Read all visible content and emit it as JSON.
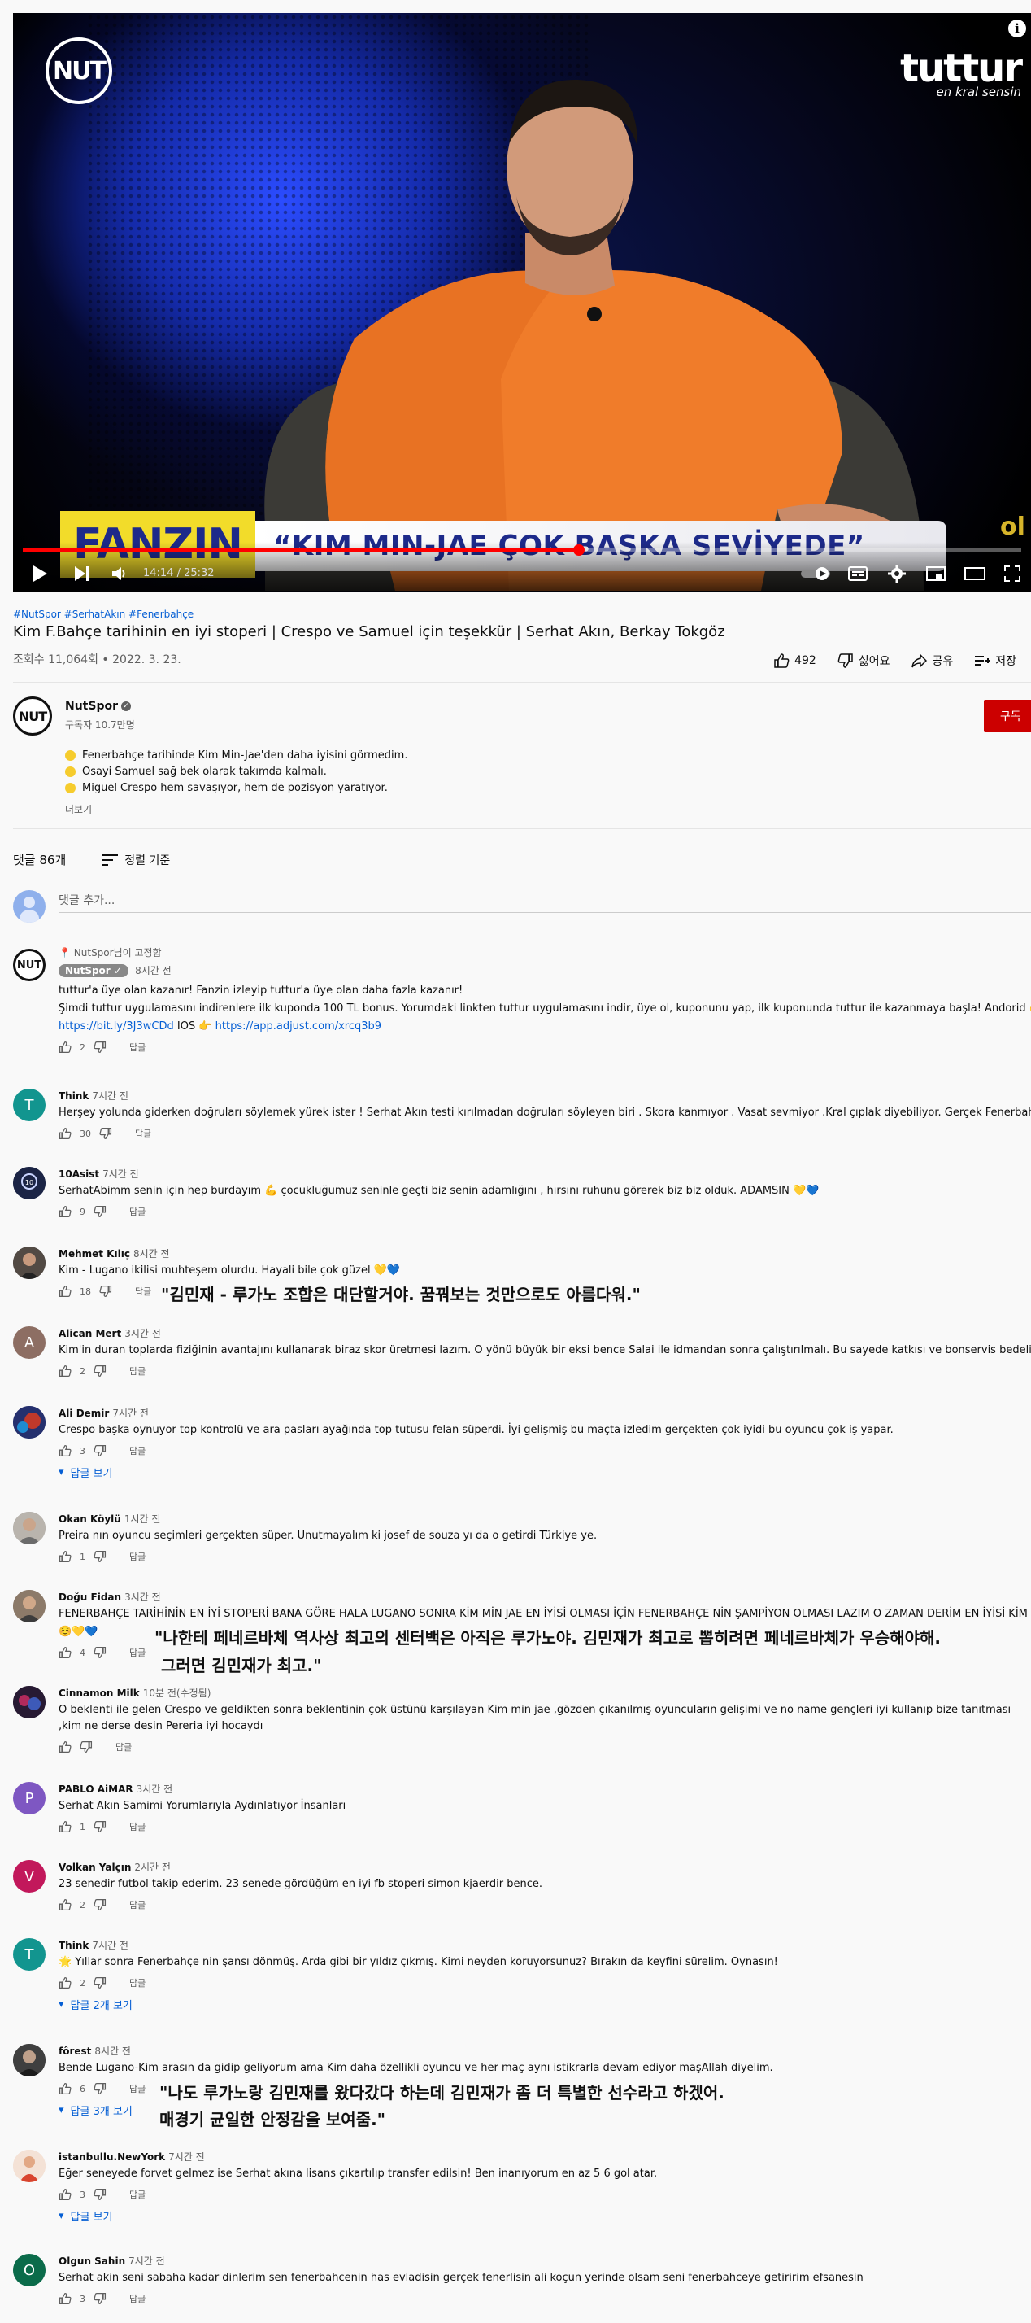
{
  "video": {
    "channel_logo_text": "NUT",
    "brand_main": "tuttur",
    "brand_sub": "en kral sensin",
    "lower_third_box": "FANZIN",
    "lower_third_headline": "“KIM MIN-JAE ÇOK BAŞKA SEVİYEDE”",
    "corner_text": "ol",
    "time_display": "14:14 / 25:32",
    "progress_fraction": 0.557
  },
  "info": {
    "tags": "#NutSpor #SerhatAkın #Fenerbahçe",
    "title": "Kim F.Bahçe tarihinin en iyi stoperi | Crespo ve Samuel için teşekkür | Serhat Akın, Berkay Tokgöz",
    "meta": "조회수 11,064회 • 2022. 3. 23.",
    "like_count": "492",
    "dislike_label": "싫어요",
    "share_label": "공유",
    "save_label": "저장"
  },
  "channel": {
    "avatar_text": "NUT",
    "name": "NutSpor",
    "subs": "구독자 10.7만명",
    "subscribe_label": "구독",
    "desc_lines": [
      "Fenerbahçe tarihinde Kim Min-Jae'den daha iyisini görmedim.",
      "Osayi Samuel sağ bek olarak takımda kalmalı.",
      "Miguel Crespo hem savaşıyor, hem de pozisyon yaratıyor."
    ],
    "more_label": "더보기"
  },
  "comments_header": {
    "count": "댓글 86개",
    "sort_label": "정렬 기준",
    "add_placeholder": "댓글 추가..."
  },
  "comments": [
    {
      "pinned": "NutSpor님이 고정함",
      "author": "NutSpor",
      "time": "8시간 전",
      "lines": [
        "tuttur'a üye olan kazanır! Fanzin izleyip tuttur'a üye olan daha fazla kazanır!",
        "Şimdi tuttur uygulamasını indirenlere ilk kuponda 100 TL bonus. Yorumdaki linkten tuttur uygulamasını indir, üye ol, kuponunu yap, ilk kuponunda tuttur ile kazanmaya başla!  Andorid 👉"
      ],
      "link1": "https://bit.ly/3J3wCDd",
      "ios_label": "IOS 👉",
      "link2": "https://app.adjust.com/xrcq3b9",
      "likes": "2",
      "reply": "답글"
    },
    {
      "avatar_letter": "T",
      "author": "Think",
      "time": "7시간 전",
      "text": "Herşey yolunda giderken doğruları söylemek yürek ister ! Serhat Akın testi kırılmadan doğruları söyleyen biri . Skora kanmıyor . Vasat sevmiyor .Kral çıplak diyebiliyor. Gerçek Fenerbahçeli !",
      "likes": "30",
      "reply": "답글"
    },
    {
      "author": "10Asist",
      "time": "7시간 전",
      "text": "SerhatAbimm senin için hep burdayım 💪 çocukluğumuz seninle geçti biz senin adamlığını , hırsını ruhunu görerek biz biz olduk. ADAMSIN 💛💙",
      "likes": "9",
      "reply": "답글"
    },
    {
      "author": "Mehmet Kılıç",
      "time": "8시간 전",
      "text": "Kim - Lugano ikilisi muhteşem olurdu. Hayali bile çok güzel 💛💙",
      "likes": "18",
      "reply": "답글",
      "overlay": "\"김민재 - 루가노 조합은 대단할거야. 꿈꿔보는 것만으로도 아름다워.\""
    },
    {
      "avatar_letter": "A",
      "author": "Alican Mert",
      "time": "3시간 전",
      "text": "Kim'in duran toplarda fiziğinin avantajını kullanarak biraz skor üretmesi lazım. O yönü büyük bir eksi bence  Salai ile idmandan sonra çalıştırılmalı. Bu sayede katkısı ve bonservis bedeli katlanabilir",
      "likes": "2",
      "reply": "답글"
    },
    {
      "author": "Ali Demir",
      "time": "7시간 전",
      "text": "Crespo başka oynuyor top kontrolü ve ara pasları ayağında top tutusu felan süperdi. İyi gelişmiş bu maçta izledim gerçekten çok iyidi bu oyuncu çok iş yapar.",
      "likes": "3",
      "reply": "답글",
      "view_replies": "답글 보기"
    },
    {
      "author": "Okan Köylü",
      "time": "1시간 전",
      "text": "Preira nın oyuncu seçimleri gerçekten süper. Unutmayalım ki josef de souza yı da o getirdi Türkiye ye.",
      "likes": "1",
      "reply": "답글"
    },
    {
      "author": "Doğu Fidan",
      "time": "3시간 전",
      "text": "FENERBAHÇE TARİHİNİN EN İYİ STOPERİ BANA GÖRE HALA LUGANO SONRA KİM MİN JAE EN İYİSİ OLMASI İÇİN FENERBAHÇE NİN ŞAMPİYON OLMASI LAZIM O ZAMAN DERİM EN İYİSİ KİM",
      "emoji": "☺️💛💙",
      "likes": "4",
      "reply": "답글",
      "overlay1": "\"나한테 페네르바체 역사상 최고의 센터백은 아직은 루가노야. 김민재가 최고로 뽑히려면 페네르바체가 우승해야해.",
      "overlay2": "그러면 김민재가 최고.\""
    },
    {
      "author": "Cinnamon Milk",
      "time": "10분 전(수정됨)",
      "text": "O beklenti ile gelen Crespo ve geldikten sonra beklentinin çok üstünü karşılayan Kim min jae ,gözden çıkanılmış oyuncuların gelişimi ve no name gençleri iyi kullanıp bize tanıtması ,kim ne derse desin Pereria iyi hocaydı",
      "reply": "답글"
    },
    {
      "avatar_letter": "P",
      "author": "PABLO AiMAR",
      "time": "3시간 전",
      "text": "Serhat Akın Samimi Yorumlarıyla Aydınlatıyor İnsanları",
      "likes": "1",
      "reply": "답글"
    },
    {
      "avatar_letter": "V",
      "author": "Volkan Yalçın",
      "time": "2시간 전",
      "text": "23 senedir futbol takip ederim. 23 senede gördüğüm en iyi fb stoperi simon kjaerdir bence.",
      "likes": "2",
      "reply": "답글"
    },
    {
      "avatar_letter": "T",
      "author": "Think",
      "time": "7시간 전",
      "text": "🌟 Yıllar sonra Fenerbahçe nin şansı dönmüş. Arda gibi bir yıldız çıkmış. Kimi neyden koruyorsunuz? Bırakın da keyfini sürelim. Oynasın!",
      "likes": "2",
      "reply": "답글",
      "view_replies": "답글 2개 보기"
    },
    {
      "author": "fôrest",
      "time": "8시간 전",
      "text": "Bende Lugano-Kim arasın da gidip geliyorum ama Kim daha özellikli oyuncu  ve her maç aynı istikrarla devam ediyor maşAllah diyelim.",
      "likes": "6",
      "reply": "답글",
      "view_replies": "답글 3개 보기",
      "overlay1": "\"나도 루가노랑 김민재를 왔다갔다 하는데 김민재가 좀 더 특별한 선수라고 하겠어.",
      "overlay2": "매경기 균일한 안정감을 보여줌.\""
    },
    {
      "author": "istanbullu.NewYork",
      "time": "7시간 전",
      "text": "Eğer seneyede forvet gelmez ise Serhat akına lisans çıkartılıp transfer edilsin! Ben inanıyorum en az 5 6 gol atar.",
      "likes": "3",
      "reply": "답글",
      "view_replies": "답글 보기"
    },
    {
      "avatar_letter": "O",
      "author": "Olgun Sahin",
      "time": "7시간 전",
      "text": "Serhat akin seni sabaha kadar dinlerim sen fenerbahcenin has evladisin gerçek fenerlisin ali koçun yerinde olsam seni fenerbahceye getiririm efsanesin",
      "likes": "3",
      "reply": "답글"
    }
  ]
}
